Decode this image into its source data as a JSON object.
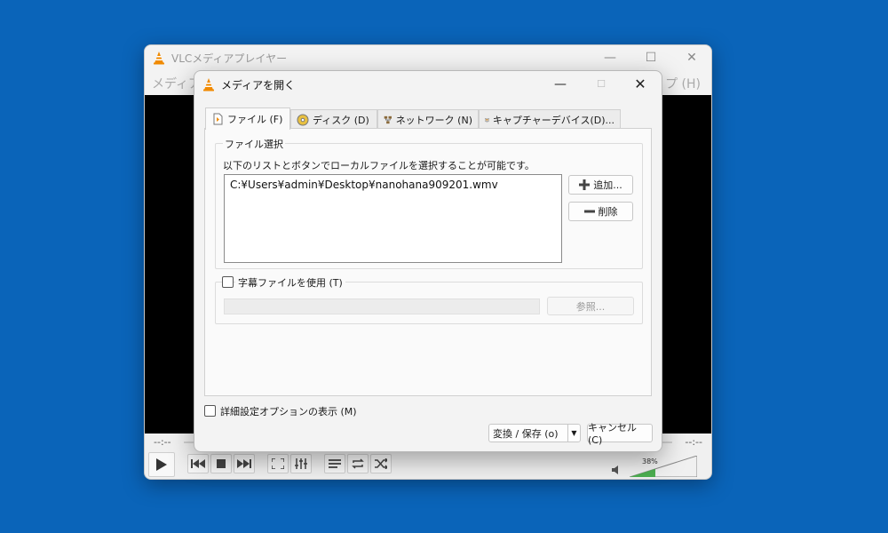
{
  "vlc": {
    "title": "VLCメディアプレイヤー",
    "menu_left": "メディア",
    "menu_right": "プ (H)",
    "time_elapsed": "--:--",
    "time_total": "--:--",
    "volume": "38%"
  },
  "dialog": {
    "title": "メディアを開く",
    "tabs": [
      {
        "label": "ファイル (F)",
        "icon": "file-icon"
      },
      {
        "label": "ディスク (D)",
        "icon": "disc-icon"
      },
      {
        "label": "ネットワーク (N)",
        "icon": "network-icon"
      },
      {
        "label": "キャプチャーデバイス(D)...",
        "icon": "capture-device-icon"
      }
    ],
    "file_group": {
      "label": "ファイル選択",
      "description": "以下のリストとボタンでローカルファイルを選択することが可能です。",
      "files": [
        "C:¥Users¥admin¥Desktop¥nanohana909201.wmv"
      ],
      "add_label": "追加...",
      "remove_label": "削除"
    },
    "subtitle_group": {
      "checkbox_label": "字幕ファイルを使用 (T)",
      "checked": false,
      "path_value": "",
      "browse_label": "参照..."
    },
    "advanced_label": "詳細設定オプションの表示 (M)",
    "advanced_checked": false,
    "convert_label": "変換 / 保存 (o)",
    "cancel_label": "キャンセル (C)"
  },
  "colors": {
    "desktop": "#0a64b9",
    "vlc_orange": "#f08a00",
    "volume_green": "#4caf50"
  }
}
